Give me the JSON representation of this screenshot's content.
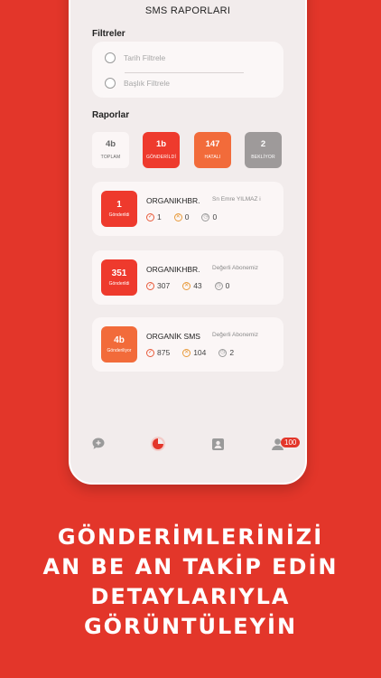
{
  "header": {
    "title": "SMS RAPORLARI"
  },
  "filters": {
    "section_label": "Filtreler",
    "options": [
      {
        "label": "Tarih Filtrele"
      },
      {
        "label": "Başlık Filtrele"
      }
    ]
  },
  "reports_section": {
    "label": "Raporlar"
  },
  "stats": [
    {
      "value": "4b",
      "label": "TOPLAM",
      "color": "#fbf6f6"
    },
    {
      "value": "1b",
      "label": "GÖNDERİLDİ",
      "color": "#ee3a2d"
    },
    {
      "value": "147",
      "label": "HATALI",
      "color": "#f26b3a"
    },
    {
      "value": "2",
      "label": "BEKLİYOR",
      "color": "#9e9a9a"
    }
  ],
  "reports": [
    {
      "badge_value": "1",
      "badge_label": "Gönderildi",
      "badge_color": "#ee3a2d",
      "sender": "ORGANIKHBR.",
      "message": "Sn Emre YILMAZ i",
      "sent": "1",
      "failed": "0",
      "pending": "0"
    },
    {
      "badge_value": "351",
      "badge_label": "Gönderildi",
      "badge_color": "#ee3a2d",
      "sender": "ORGANIKHBR.",
      "message": "Değerli Abonemiz",
      "sent": "307",
      "failed": "43",
      "pending": "0"
    },
    {
      "badge_value": "4b",
      "badge_label": "Gönderiliyor",
      "badge_color": "#f26b3a",
      "sender": "ORGANİK SMS",
      "message": "Değerli Abonemiz",
      "sent": "875",
      "failed": "104",
      "pending": "2"
    }
  ],
  "tabbar": {
    "items": [
      {
        "icon": "new-message-icon"
      },
      {
        "icon": "reports-pie-icon"
      },
      {
        "icon": "contacts-icon"
      },
      {
        "icon": "profile-icon"
      }
    ],
    "notification_count": "100"
  },
  "promo": {
    "line1": "GÖNDERİMLERİNİZİ",
    "line2": "AN BE AN TAKİP EDİN",
    "line3": "DETAYLARIYLA",
    "line4": "GÖRÜNTÜLEYİN"
  },
  "colors": {
    "accent": "#e3362a",
    "sent": "#ee3a2d",
    "failed": "#f26b3a",
    "pending": "#9e9a9a"
  }
}
